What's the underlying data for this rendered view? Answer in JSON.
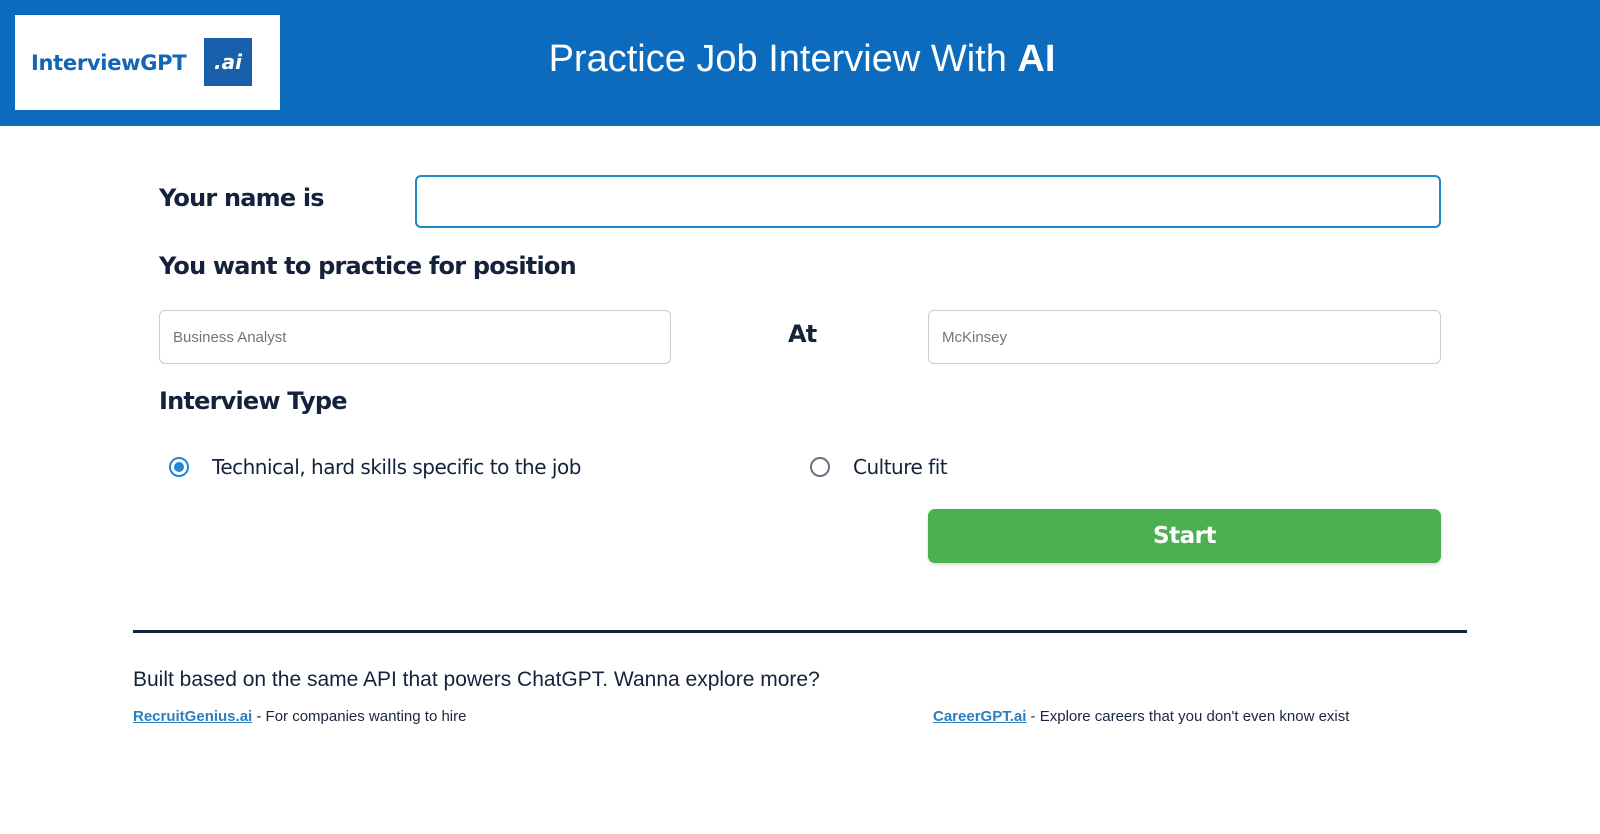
{
  "header": {
    "logo_text": "InterviewGPT",
    "logo_badge": ".ai",
    "title_main": "Practice Job Interview With ",
    "title_bold": "AI"
  },
  "form": {
    "name_label": "Your name is",
    "name_value": "",
    "position_label": "You want to practice for position",
    "position_placeholder": "Business Analyst",
    "at_label": "At",
    "company_placeholder": "McKinsey",
    "interview_type_label": "Interview Type",
    "options": [
      {
        "label": "Technical, hard skills specific to the job",
        "selected": true
      },
      {
        "label": "Culture fit",
        "selected": false
      }
    ],
    "start_label": "Start"
  },
  "footer": {
    "tagline": "Built based on the same API that powers ChatGPT. Wanna explore more?",
    "links": [
      {
        "name": "RecruitGenius.ai",
        "description": " - For companies wanting to hire"
      },
      {
        "name": "CareerGPT.ai",
        "description": " - Explore careers that you don't even know exist"
      }
    ]
  },
  "colors": {
    "header_bg": "#0d6bbd",
    "start_button": "#4caf50",
    "link": "#2a7fc1"
  }
}
